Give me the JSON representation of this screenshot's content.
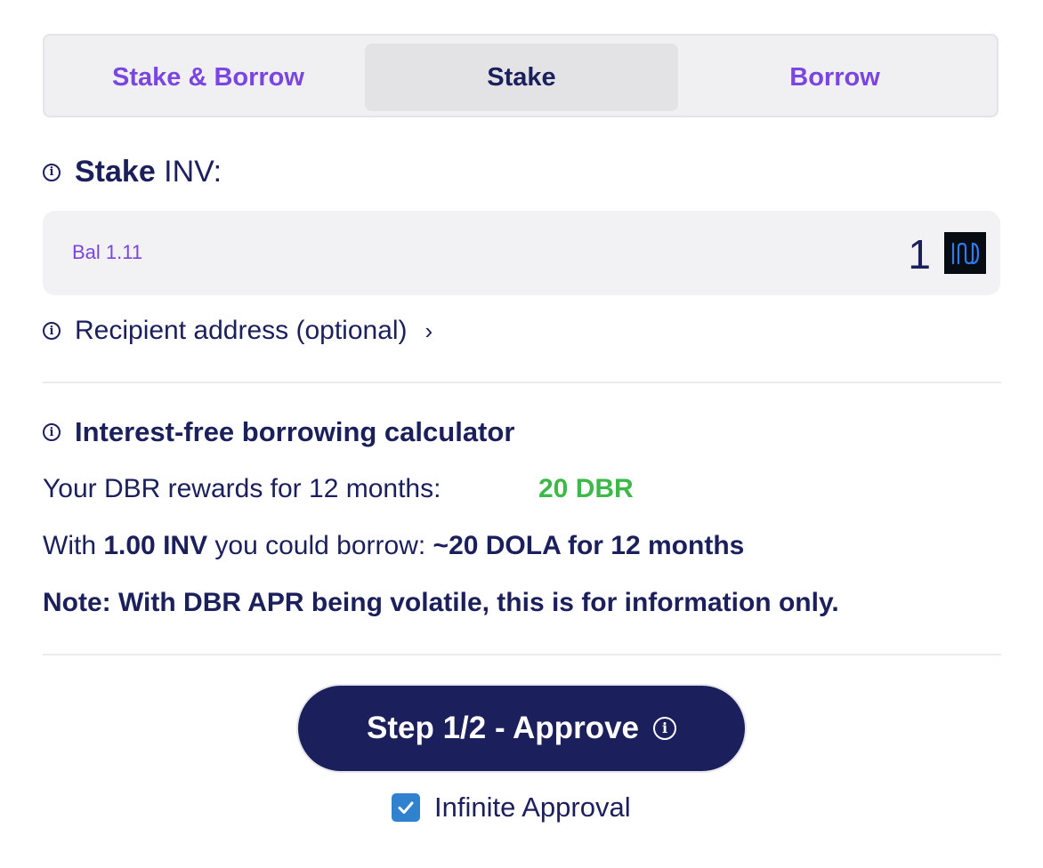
{
  "tabs": [
    {
      "label": "Stake & Borrow",
      "active": false
    },
    {
      "label": "Stake",
      "active": true
    },
    {
      "label": "Borrow",
      "active": false
    }
  ],
  "stake": {
    "title_bold": "Stake",
    "title_rest": " INV:",
    "balance": "Bal 1.11",
    "amount": "1",
    "token_icon": "inv-token-icon"
  },
  "recipient": {
    "label": "Recipient address (optional)",
    "chevron": "›"
  },
  "calculator": {
    "title": "Interest-free borrowing calculator",
    "rewards_label": "Your DBR rewards for 12 months:",
    "rewards_value": "20 DBR",
    "borrow_prefix": "With ",
    "borrow_amount": "1.00 INV",
    "borrow_mid": " you could borrow: ",
    "borrow_result": "~20 DOLA for 12 months",
    "note": "Note: With DBR APR being volatile, this is for information only."
  },
  "approve": {
    "label": "Step 1/2 - Approve"
  },
  "infinite_approval": {
    "label": "Infinite Approval",
    "checked": true
  },
  "colors": {
    "primary": "#1b1f5c",
    "accent": "#7a45e0",
    "success": "#3fb84a",
    "checkbox": "#3182ce"
  }
}
